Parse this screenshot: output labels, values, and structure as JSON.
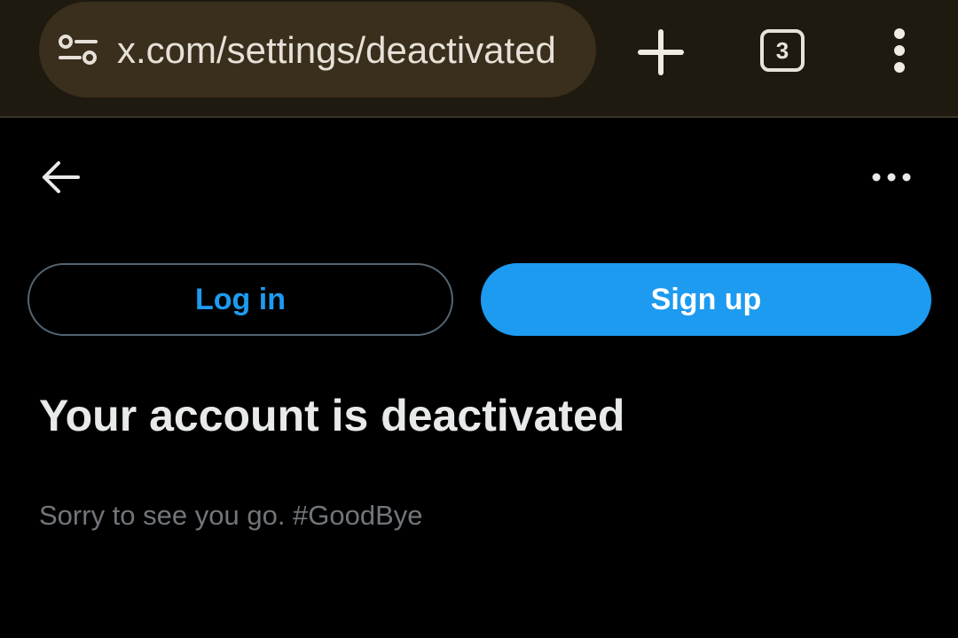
{
  "browser": {
    "url": "x.com/settings/deactivated",
    "tab_count": "3",
    "icons": {
      "site_settings": "tune-icon",
      "new_tab": "plus-icon",
      "overflow": "vertical-dots-icon"
    }
  },
  "header": {
    "back_icon": "arrow-left-icon",
    "more_icon": "horizontal-dots-icon"
  },
  "actions": {
    "login_label": "Log in",
    "signup_label": "Sign up"
  },
  "content": {
    "headline": "Your account is deactivated",
    "message": "Sorry to see you go. #GoodBye"
  },
  "colors": {
    "accent": "#1d9bf0",
    "background": "#000000",
    "primary_text": "#e7e9ea",
    "secondary_text": "#71767b",
    "chrome_bar": "#1f1a10",
    "url_pill": "#3a2e1c"
  }
}
